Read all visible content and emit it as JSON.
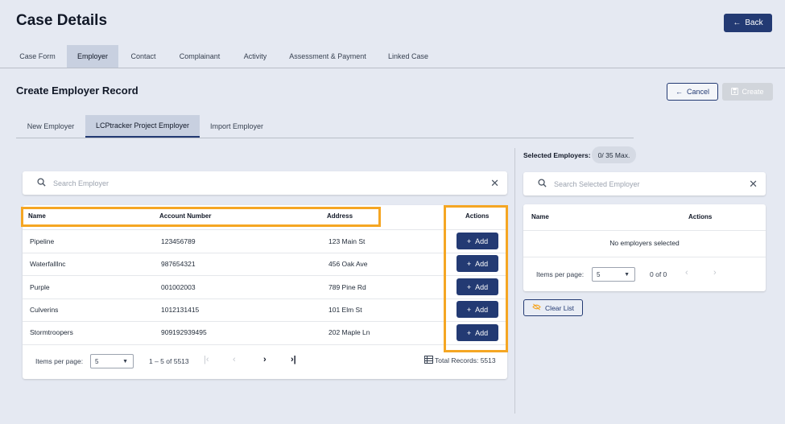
{
  "page": {
    "title": "Case Details",
    "back_label": "Back"
  },
  "top_tabs": [
    {
      "label": "Case Form"
    },
    {
      "label": "Employer"
    },
    {
      "label": "Contact"
    },
    {
      "label": "Complainant"
    },
    {
      "label": "Activity"
    },
    {
      "label": "Assessment & Payment"
    },
    {
      "label": "Linked Case"
    }
  ],
  "section": {
    "title": "Create Employer Record",
    "cancel_label": "Cancel",
    "create_label": "Create"
  },
  "sub_tabs": [
    {
      "label": "New Employer"
    },
    {
      "label": "LCPtracker Project Employer"
    },
    {
      "label": "Import Employer"
    }
  ],
  "employer_search": {
    "placeholder": "Search Employer"
  },
  "employer_table": {
    "headers": {
      "name": "Name",
      "account": "Account Number",
      "address": "Address",
      "actions": "Actions"
    },
    "rows": [
      {
        "name": "Pipeline",
        "account": "123456789",
        "address": "123 Main St",
        "action": "Add"
      },
      {
        "name": "WaterfallInc",
        "account": "987654321",
        "address": "456 Oak Ave",
        "action": "Add"
      },
      {
        "name": "Purple",
        "account": "001002003",
        "address": "789 Pine Rd",
        "action": "Add"
      },
      {
        "name": "Culverins",
        "account": "1012131415",
        "address": "101 Elm St",
        "action": "Add"
      },
      {
        "name": "Stormtroopers",
        "account": "909192939495",
        "address": "202 Maple Ln",
        "action": "Add"
      }
    ]
  },
  "employer_pagination": {
    "items_label": "Items per page:",
    "items_value": "5",
    "range": "1 – 5 of 5513",
    "total": "Total Records: 5513"
  },
  "selected": {
    "label": "Selected Employers:",
    "badge": "0/ 35 Max.",
    "search_placeholder": "Search Selected Employer",
    "headers": {
      "name": "Name",
      "actions": "Actions"
    },
    "empty": "No employers selected",
    "items_label": "Items per page:",
    "items_value": "5",
    "range": "0 of 0",
    "clear_label": "Clear List"
  },
  "colors": {
    "primary": "#233a73",
    "highlight": "#f5a623",
    "background": "#e5e9f2"
  }
}
